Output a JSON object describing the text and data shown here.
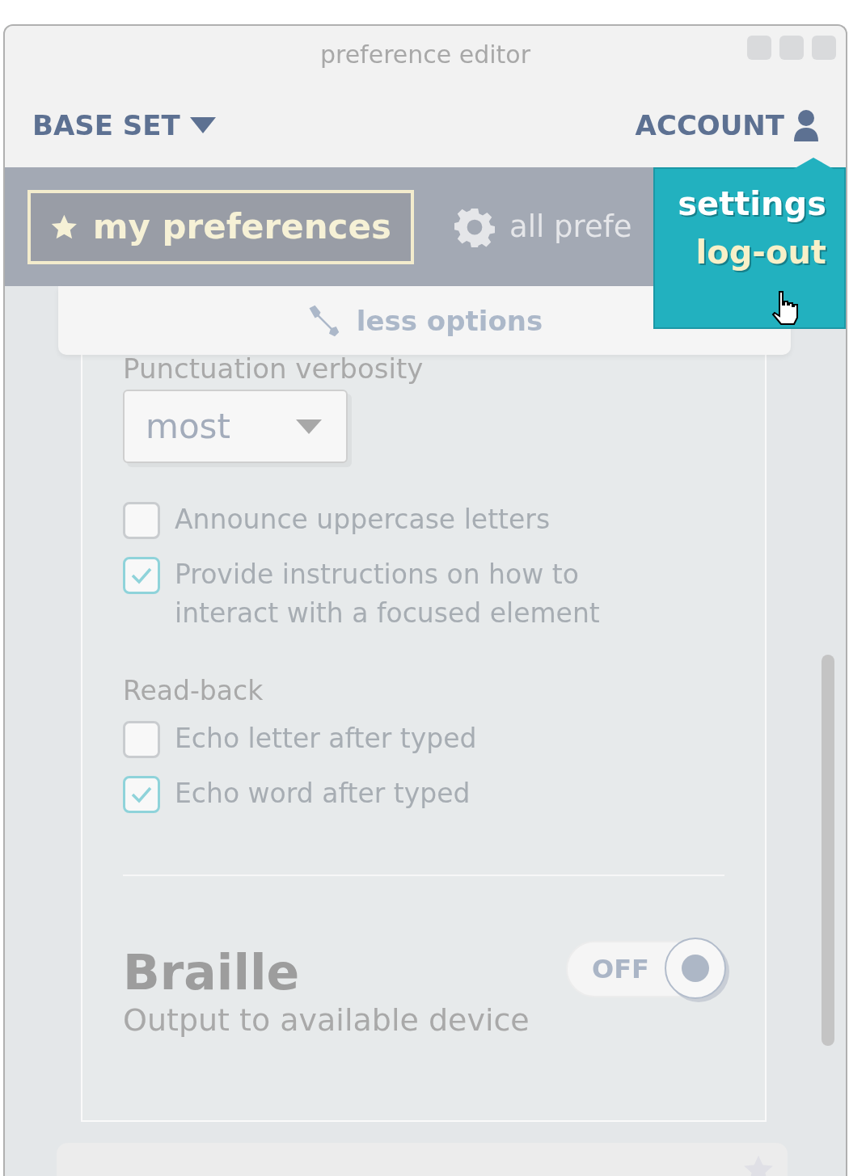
{
  "window": {
    "title": "preference editor"
  },
  "header": {
    "base_set": "BASE SET",
    "account": "ACCOUNT"
  },
  "tabs": [
    {
      "label": "my preferences",
      "selected": true,
      "kind": "star"
    },
    {
      "label": "all prefe",
      "selected": false,
      "kind": "gear"
    }
  ],
  "account_menu": {
    "items": [
      {
        "label": "settings",
        "selected": false
      },
      {
        "label": "log-out",
        "selected": true
      }
    ]
  },
  "options_toggle": "less options",
  "speech": {
    "punctuation_label": "Punctuation verbosity",
    "punctuation_value": "most",
    "checkboxes": [
      {
        "label": "Announce uppercase letters",
        "checked": false
      },
      {
        "label": "Provide instructions on how to interact with a focused element",
        "checked": true
      }
    ],
    "readback_label": "Read-back",
    "readback": [
      {
        "label": "Echo letter after typed",
        "checked": false
      },
      {
        "label": "Echo word after typed",
        "checked": true
      }
    ]
  },
  "braille": {
    "title": "Braille",
    "subtitle": "Output to available device",
    "toggle": {
      "label": "OFF",
      "on": false
    }
  }
}
